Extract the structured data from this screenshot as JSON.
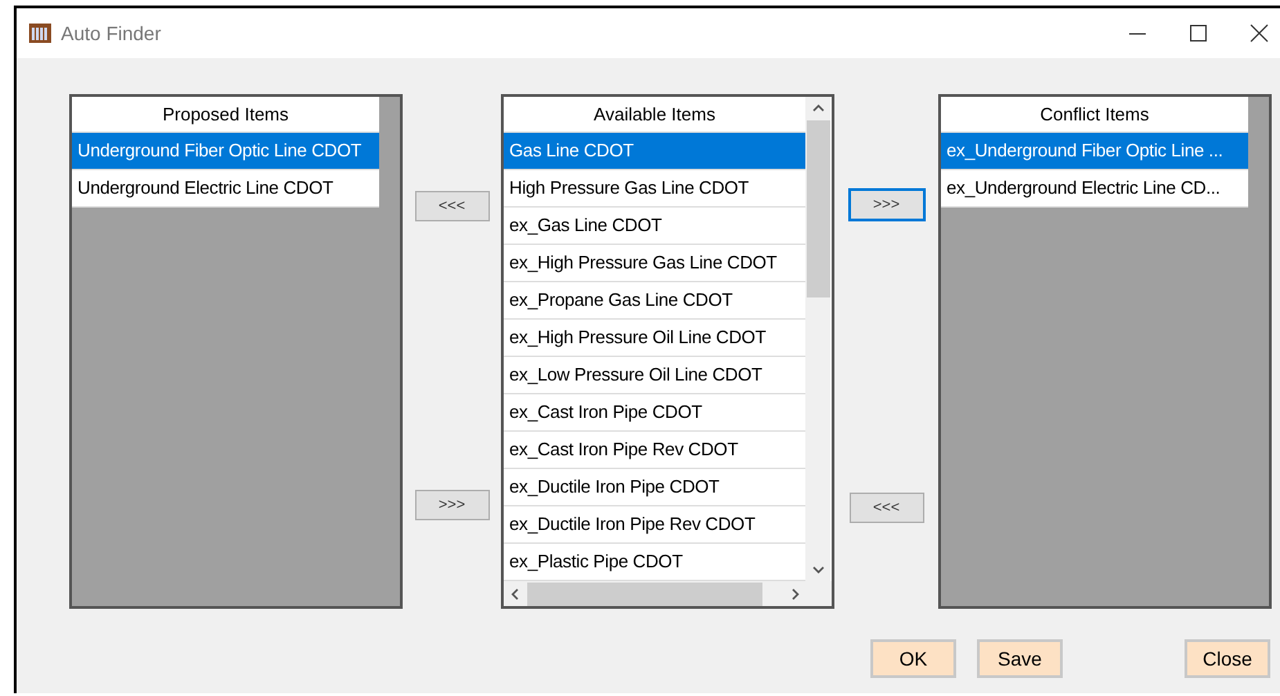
{
  "window": {
    "title": "Auto Finder"
  },
  "proposed_items": {
    "header": "Proposed Items",
    "items": [
      {
        "label": "Underground Fiber Optic Line CDOT",
        "selected": true
      },
      {
        "label": "Underground Electric Line CDOT",
        "selected": false
      }
    ]
  },
  "left_transfer_buttons": [
    {
      "label": "<<<",
      "focused": false
    },
    {
      "label": ">>>",
      "focused": false
    }
  ],
  "available_items": {
    "header": "Available Items",
    "items": [
      {
        "label": "Gas Line CDOT",
        "selected": true
      },
      {
        "label": "High Pressure Gas Line CDOT",
        "selected": false
      },
      {
        "label": "ex_Gas Line CDOT",
        "selected": false
      },
      {
        "label": "ex_High Pressure Gas Line CDOT",
        "selected": false
      },
      {
        "label": "ex_Propane Gas Line CDOT",
        "selected": false
      },
      {
        "label": "ex_High Pressure Oil Line CDOT",
        "selected": false
      },
      {
        "label": "ex_Low Pressure Oil Line CDOT",
        "selected": false
      },
      {
        "label": "ex_Cast Iron Pipe CDOT",
        "selected": false
      },
      {
        "label": "ex_Cast Iron Pipe Rev CDOT",
        "selected": false
      },
      {
        "label": "ex_Ductile Iron Pipe CDOT",
        "selected": false
      },
      {
        "label": "ex_Ductile Iron Pipe Rev CDOT",
        "selected": false
      },
      {
        "label": "ex_Plastic Pipe CDOT",
        "selected": false
      }
    ]
  },
  "right_transfer_buttons": [
    {
      "label": ">>>",
      "focused": true
    },
    {
      "label": "<<<",
      "focused": false
    }
  ],
  "conflict_items": {
    "header": "Conflict Items",
    "items": [
      {
        "label": "ex_Underground Fiber Optic Line ...",
        "selected": true
      },
      {
        "label": "ex_Underground Electric Line CD...",
        "selected": false
      }
    ]
  },
  "dialog_buttons": [
    "OK",
    "Save",
    "Close"
  ]
}
